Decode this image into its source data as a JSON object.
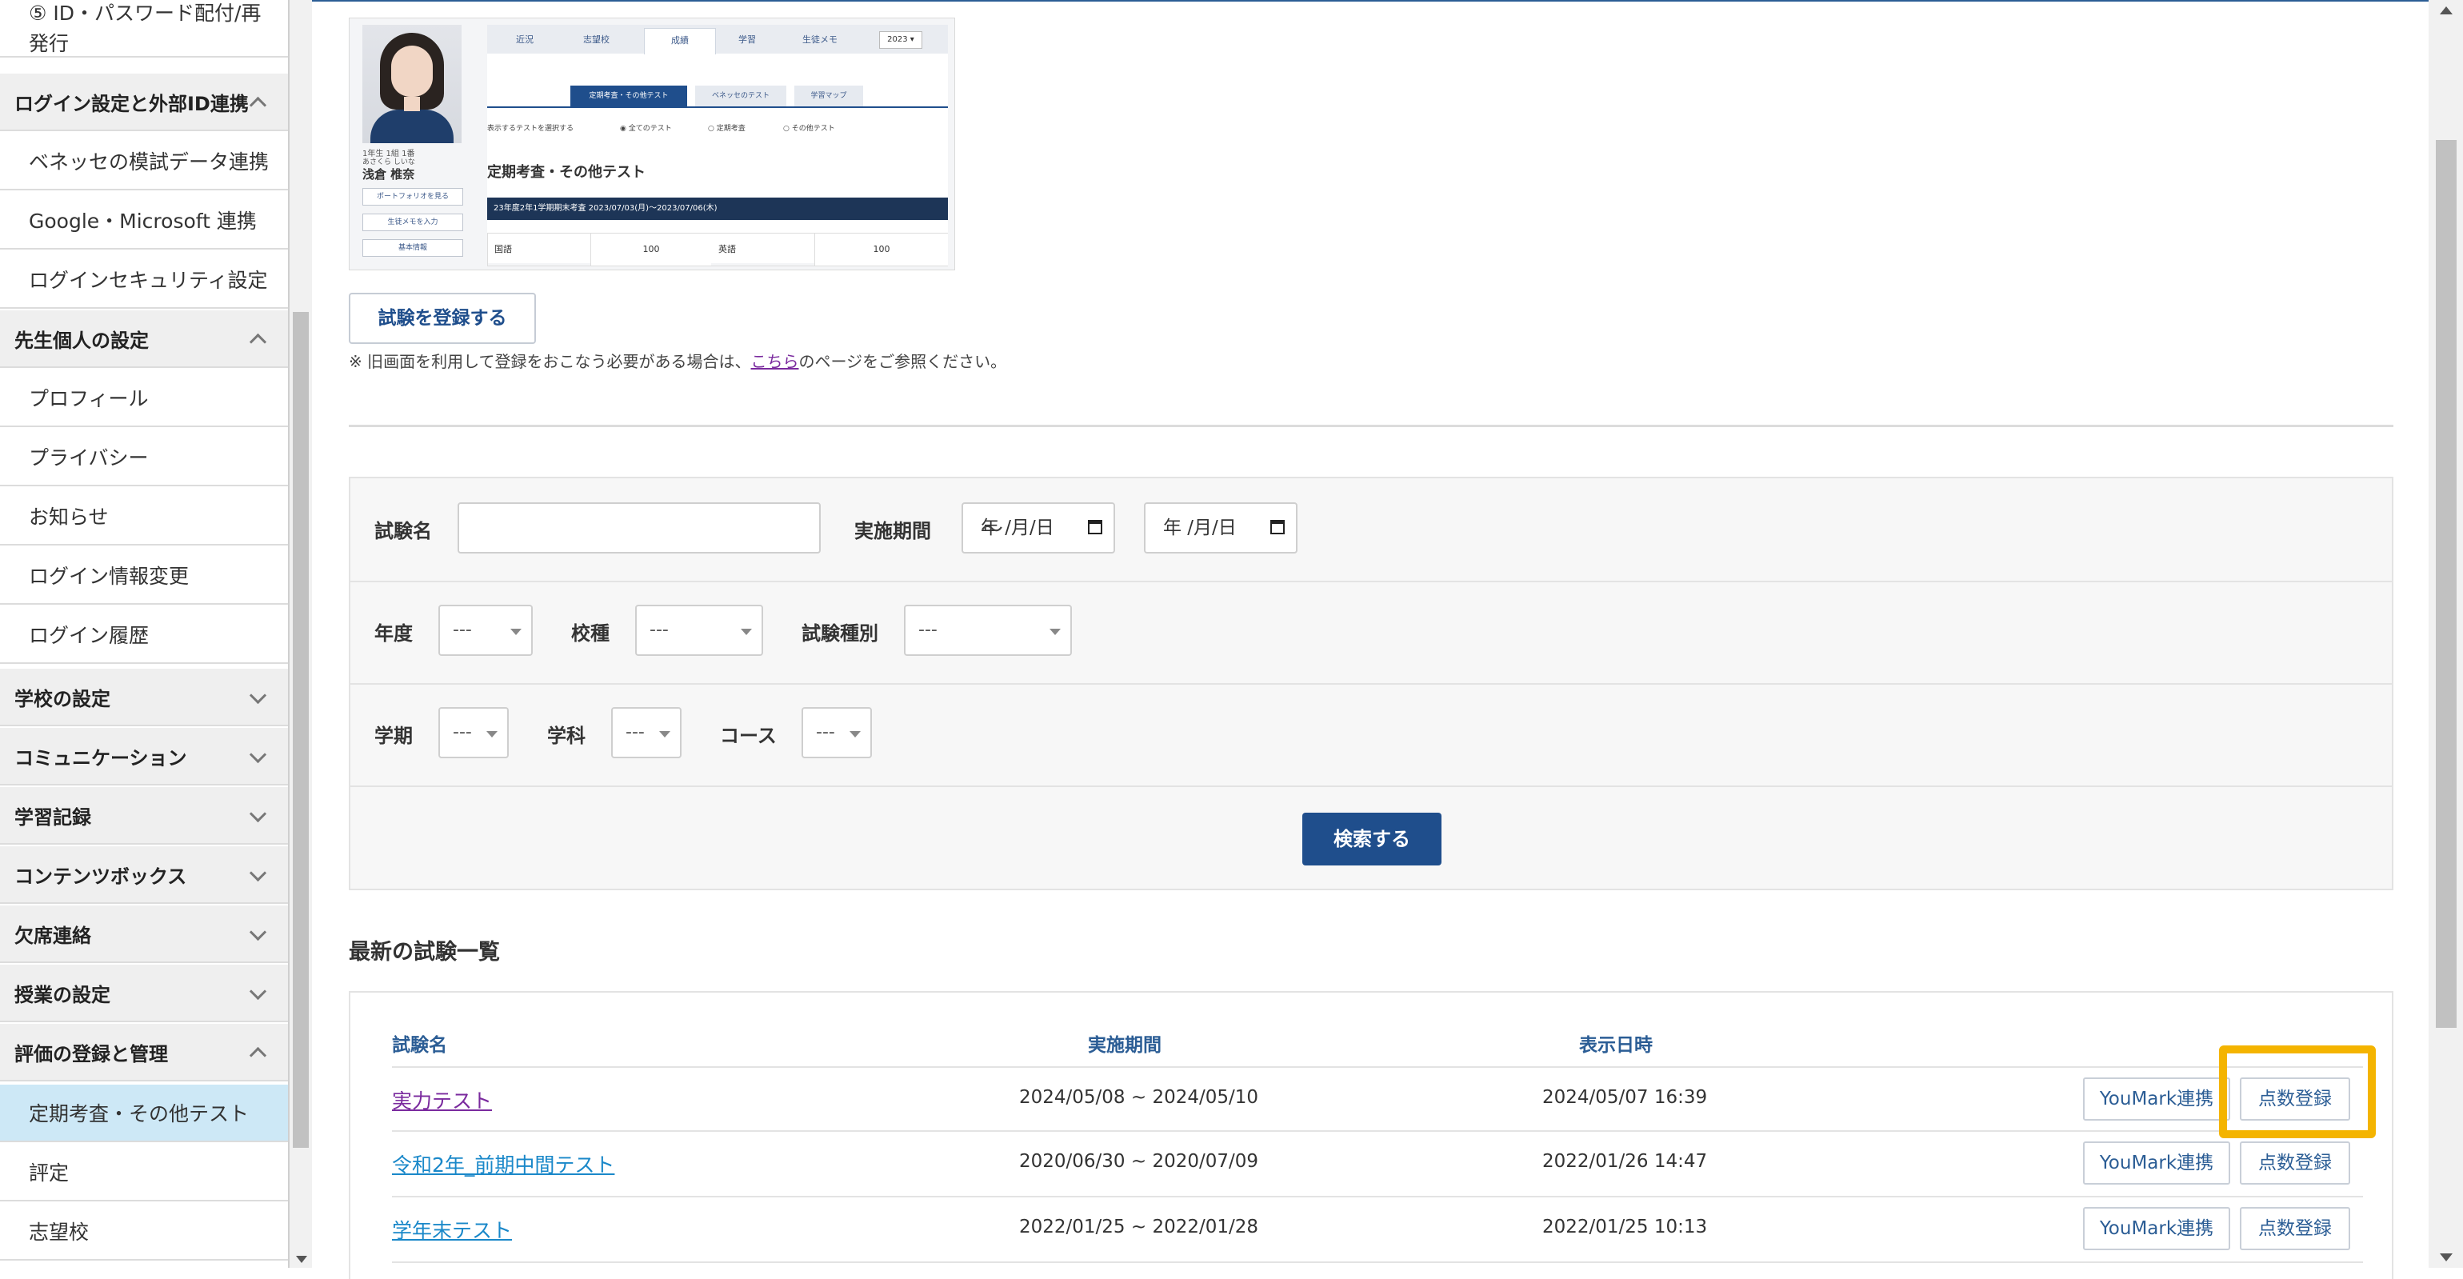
{
  "sidebar": {
    "items": [
      {
        "type": "sub",
        "label": "⑤ ID・パスワード配付/再発行",
        "line1": "⑤ ID・パスワード配付/再",
        "line2": "発行"
      },
      {
        "type": "head",
        "label": "ログイン設定と外部ID連携",
        "expanded": true
      },
      {
        "type": "sub",
        "label": "ベネッセの模試データ連携"
      },
      {
        "type": "sub",
        "label": "Google・Microsoft 連携"
      },
      {
        "type": "sub",
        "label": "ログインセキュリティ設定"
      },
      {
        "type": "head",
        "label": "先生個人の設定",
        "expanded": true
      },
      {
        "type": "sub",
        "label": "プロフィール"
      },
      {
        "type": "sub",
        "label": "プライバシー"
      },
      {
        "type": "sub",
        "label": "お知らせ"
      },
      {
        "type": "sub",
        "label": "ログイン情報変更"
      },
      {
        "type": "sub",
        "label": "ログイン履歴"
      },
      {
        "type": "head",
        "label": "学校の設定",
        "expanded": false
      },
      {
        "type": "head",
        "label": "コミュニケーション",
        "expanded": false
      },
      {
        "type": "head",
        "label": "学習記録",
        "expanded": false
      },
      {
        "type": "head",
        "label": "コンテンツボックス",
        "expanded": false
      },
      {
        "type": "head",
        "label": "欠席連絡",
        "expanded": false
      },
      {
        "type": "head",
        "label": "授業の設定",
        "expanded": false
      },
      {
        "type": "head",
        "label": "評価の登録と管理",
        "expanded": true
      },
      {
        "type": "sub",
        "label": "定期考査・その他テスト",
        "active": true
      },
      {
        "type": "sub",
        "label": "評定"
      },
      {
        "type": "sub",
        "label": "志望校"
      }
    ]
  },
  "preview": {
    "student_grade": "1年生 1組 1番",
    "student_kana": "あさくら しいな",
    "student_name": "浅倉 椎奈",
    "side_buttons": [
      "ポートフォリオを見る",
      "生徒メモを入力",
      "基本情報"
    ],
    "tabs": [
      "近況",
      "志望校",
      "成績",
      "学習",
      "生徒メモ"
    ],
    "year": "2023 ▾",
    "subtabs": [
      "定期考査・その他テスト",
      "ベネッセのテスト",
      "学習マップ"
    ],
    "filter_label": "表示するテストを選択する",
    "filter_options": [
      "全てのテスト",
      "定期考査",
      "その他テスト"
    ],
    "section_title": "定期考査・その他テスト",
    "exam_bar": "23年度2年1学期期末考査  2023/07/03(月)〜2023/07/06(木)",
    "scores": [
      {
        "subject": "国語",
        "score": "100"
      },
      {
        "subject": "英語",
        "score": "100"
      }
    ]
  },
  "register_button": "試験を登録する",
  "note": {
    "prefix": "※ 旧画面を利用して登録をおこなう必要がある場合は、",
    "link": "こちら",
    "suffix": "のページをご参照ください。"
  },
  "search": {
    "exam_name_label": "試験名",
    "exam_name_value": "",
    "period_label": "実施期間",
    "date_from": "年 /月/日",
    "date_to": "年 /月/日",
    "tilde": "〜",
    "year_label": "年度",
    "school_type_label": "校種",
    "exam_type_label": "試験種別",
    "term_label": "学期",
    "department_label": "学科",
    "course_label": "コース",
    "select_placeholder": "---",
    "search_button": "検索する"
  },
  "list": {
    "title": "最新の試験一覧",
    "headers": [
      "試験名",
      "実施期間",
      "表示日時"
    ],
    "rows": [
      {
        "name": "実力テスト",
        "period": "2024/05/08 ~ 2024/05/10",
        "display": "2024/05/07 16:39",
        "visited": true
      },
      {
        "name": "令和2年_前期中間テスト",
        "period": "2020/06/30 ~ 2020/07/09",
        "display": "2022/01/26 14:47",
        "visited": false
      },
      {
        "name": "学年末テスト",
        "period": "2022/01/25 ~ 2022/01/28",
        "display": "2022/01/25 10:13",
        "visited": false
      }
    ],
    "youmark_button": "YouMark連携",
    "score_button": "点数登録"
  },
  "colors": {
    "primary": "#1f4e8c",
    "highlight": "#f4b400",
    "active_bg": "#cde8f6"
  }
}
